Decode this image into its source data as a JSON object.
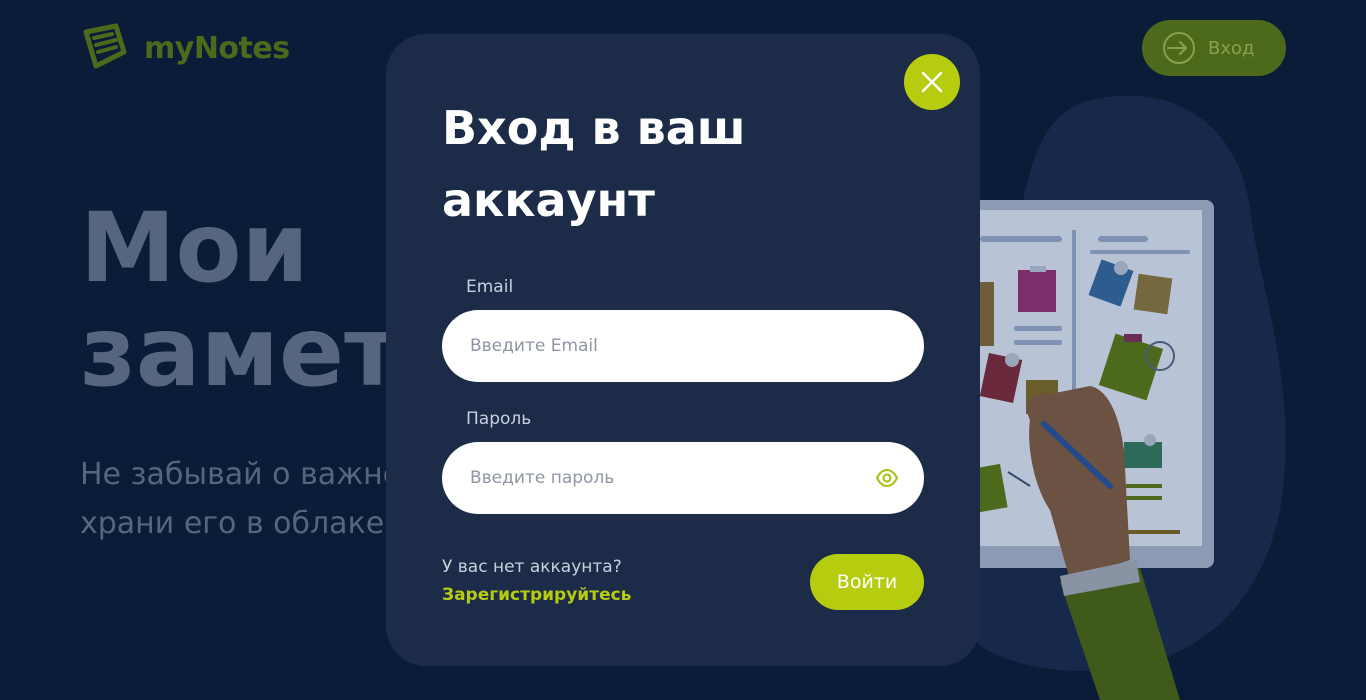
{
  "header": {
    "logo_text": "myNotes",
    "login_label": "Вход"
  },
  "hero": {
    "title_line1": "Мои",
    "title_line2": "заметки",
    "subtitle_line1": "Не забывай о важном,",
    "subtitle_line2": "храни его в облаке"
  },
  "modal": {
    "title_line1": "Вход в ваш",
    "title_line2": "аккаунт",
    "email_label": "Email",
    "email_placeholder": "Введите Email",
    "email_value": "",
    "password_label": "Пароль",
    "password_placeholder": "Введите пароль",
    "password_value": "",
    "no_account_text": "У вас нет аккаунта?",
    "register_link": "Зарегистрируйтесь",
    "submit_label": "Войти",
    "close_icon": "close-icon",
    "eye_icon": "eye-icon"
  },
  "colors": {
    "background": "#0b1c38",
    "modal": "#1c2c48",
    "accent": "#b6cc0f",
    "accent_dim": "#4d6a1c"
  }
}
